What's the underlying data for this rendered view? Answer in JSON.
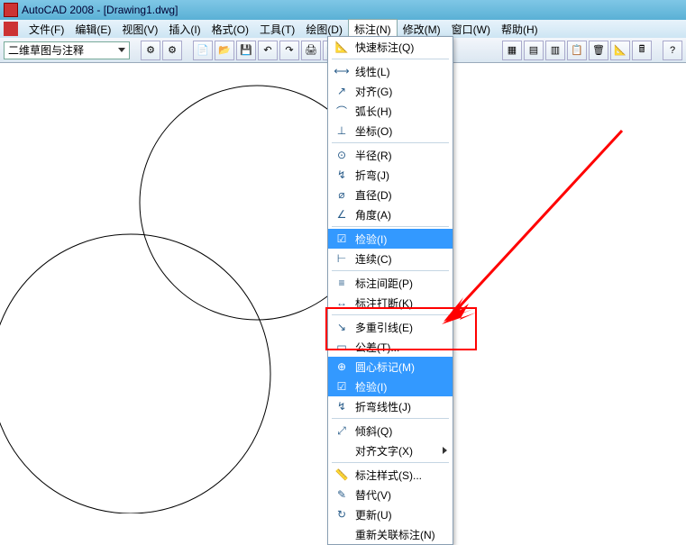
{
  "title": "AutoCAD 2008 - [Drawing1.dwg]",
  "menus": {
    "file": "文件(F)",
    "edit": "编辑(E)",
    "view": "视图(V)",
    "insert": "插入(I)",
    "format": "格式(O)",
    "tools": "工具(T)",
    "draw": "绘图(D)",
    "dimension": "标注(N)",
    "modify": "修改(M)",
    "window": "窗口(W)",
    "help": "帮助(H)"
  },
  "combo_value": "二维草图与注释",
  "dropdown": {
    "quick": "快速标注(Q)",
    "linear": "线性(L)",
    "aligned": "对齐(G)",
    "arc": "弧长(H)",
    "ordinate": "坐标(O)",
    "radius": "半径(R)",
    "jog": "折弯(J)",
    "diameter": "直径(D)",
    "angular": "角度(A)",
    "inspect1": "检验(I)",
    "continue": "连续(C)",
    "dimspace": "标注间距(P)",
    "dimbreak": "标注打断(K)",
    "mleader": "多重引线(E)",
    "tolerance": "公差(T)...",
    "center": "圆心标记(M)",
    "inspect2": "检验(I)",
    "joglinear": "折弯线性(J)",
    "oblique": "倾斜(Q)",
    "aligntext": "对齐文字(X)",
    "dimstyle": "标注样式(S)...",
    "override": "替代(V)",
    "update": "更新(U)",
    "reassoc": "重新关联标注(N)"
  }
}
